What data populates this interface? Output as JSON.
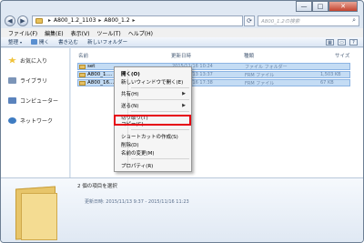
{
  "window": {
    "min_glyph": "—",
    "max_glyph": "□",
    "close_glyph": "✕"
  },
  "address": {
    "back_glyph": "◀",
    "forward_glyph": "▶",
    "breadcrumbs": [
      "A800_1.2_1103",
      "A800_1.2"
    ],
    "separator": "▸",
    "search_placeholder": "A800_1.2の検索",
    "refresh_glyph": "⟳",
    "search_glyph": "⌕"
  },
  "menubar": {
    "items": [
      "ファイル(F)",
      "編集(E)",
      "表示(V)",
      "ツール(T)",
      "ヘルプ(H)"
    ]
  },
  "toolbar": {
    "items": [
      "整理",
      "開く",
      "書き込む",
      "新しいフォルダー"
    ],
    "organize_arrow": "▾"
  },
  "navpane": {
    "items": [
      "お気に入り",
      "ライブラリ",
      "コンピューター",
      "ネットワーク"
    ]
  },
  "columns": {
    "name": "名前",
    "date": "更新日時",
    "type": "種類",
    "size": "サイズ"
  },
  "files": [
    {
      "name": "set",
      "date": "2015/11/16 10:24",
      "type": "ファイル フォルダー",
      "size": ""
    },
    {
      "name": "A800_1....",
      "date": "2015/11/13 13:37",
      "type": "FRM ファイル",
      "size": "1,503 KB"
    },
    {
      "name": "A800_16...",
      "date": "2015/11/16 17:38",
      "type": "FRM ファイル",
      "size": "67 KB"
    }
  ],
  "context_menu": {
    "items": [
      {
        "label": "開く(O)",
        "bold": true,
        "submenu": false
      },
      {
        "label": "新しいウィンドウで開く(E)",
        "bold": false,
        "submenu": false
      },
      {
        "label": "共有(H)",
        "bold": false,
        "submenu": true
      },
      {
        "label": "送る(N)",
        "bold": false,
        "submenu": true
      },
      {
        "label": "切り取り(T)",
        "bold": false,
        "submenu": false
      },
      {
        "label": "コピー(C)",
        "bold": false,
        "submenu": false
      },
      {
        "label": "ショートカットの作成(S)",
        "bold": false,
        "submenu": false
      },
      {
        "label": "削除(D)",
        "bold": false,
        "submenu": false
      },
      {
        "label": "名前の変更(M)",
        "bold": false,
        "submenu": false
      },
      {
        "label": "プロパティ(R)",
        "bold": false,
        "submenu": false
      }
    ],
    "submenu_glyph": "▶",
    "highlighted": "コピー(C)",
    "highlight_color": "#e60012"
  },
  "details": {
    "selection_text": "2 個の項目を選択",
    "date_text": "更新日時: 2015/11/13 9:37 - 2015/11/16 11:23"
  }
}
